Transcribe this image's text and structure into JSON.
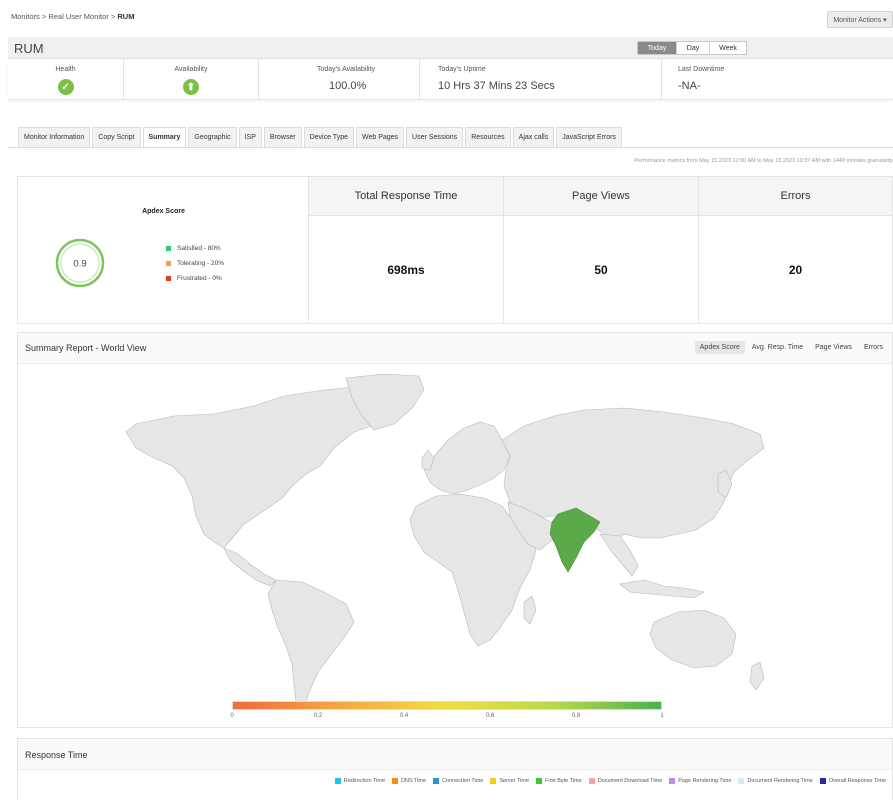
{
  "breadcrumb": {
    "part1": "Monitors",
    "sep": ">",
    "part2": "Real User Monitor",
    "part3": "RUM"
  },
  "monitor_actions": "Monitor Actions ▾",
  "page_title": "RUM",
  "periods": [
    "Today",
    "Day",
    "Week"
  ],
  "status": {
    "health_label": "Health",
    "availability_label": "Availability",
    "todays_availability_label": "Today's Availability",
    "todays_availability_value": "100.0%",
    "todays_uptime_label": "Today's Uptime",
    "todays_uptime_value": "10 Hrs 37 Mins 23 Secs",
    "last_downtime_label": "Last Downtime",
    "last_downtime_value": "-NA-"
  },
  "tabs": [
    "Monitor Information",
    "Copy Script",
    "Summary",
    "Geographic",
    "ISP",
    "Browser",
    "Device Type",
    "Web Pages",
    "User Sessions",
    "Resources",
    "Ajax calls",
    "JavaScript Errors"
  ],
  "perf_note": "Performance metrics from May 15,2023 12:00 AM to May 15,2023 10:37 AM with 1440 minutes granularity",
  "apdex": {
    "title": "Apdex Score",
    "score": "0.9",
    "legend": [
      "Satisfied - 80%",
      "Tolerating - 20%",
      "Frustrated - 0%"
    ],
    "colors": [
      "#2ecc71",
      "#f0a048",
      "#e03b24"
    ]
  },
  "metrics": {
    "total_response_time_label": "Total Response Time",
    "total_response_time_value": "698ms",
    "page_views_label": "Page Views",
    "page_views_value": "50",
    "errors_label": "Errors",
    "errors_value": "20"
  },
  "world": {
    "title": "Summary Report - World View",
    "view_tabs": [
      "Apdex Score",
      "Avg. Resp. Time",
      "Page Views",
      "Errors"
    ],
    "highlighted_country": "India",
    "highlight_color": "#5aaa4a",
    "land_color": "#e6e6e6",
    "scale_ticks": [
      "0",
      "0.2",
      "0.4",
      "0.6",
      "0.8",
      "1"
    ]
  },
  "response_time": {
    "title": "Response Time",
    "legend": [
      {
        "label": "Redirection Time",
        "color": "#1ec8e0"
      },
      {
        "label": "DNS Time",
        "color": "#f5900f"
      },
      {
        "label": "Connection Time",
        "color": "#2a94c8"
      },
      {
        "label": "Server Time",
        "color": "#e8d21a"
      },
      {
        "label": "First Byte Time",
        "color": "#3ec43e"
      },
      {
        "label": "Document Download Time",
        "color": "#f4a3a3"
      },
      {
        "label": "Page Rendering Time",
        "color": "#c08be0"
      },
      {
        "label": "Document Rendering Time",
        "color": "#c7f0f7"
      },
      {
        "label": "Overall Response Time",
        "color": "#2b2a9a"
      }
    ]
  }
}
